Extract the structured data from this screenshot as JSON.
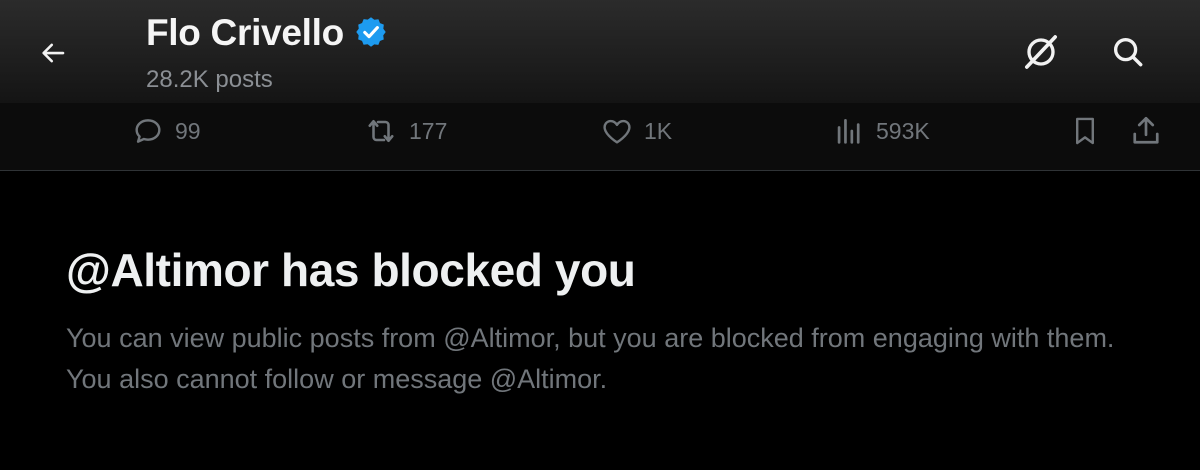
{
  "header": {
    "profile_name": "Flo Crivello",
    "post_count": "28.2K posts",
    "verified": true,
    "verified_color": "#1d9bf0",
    "icons": [
      "back-arrow-icon",
      "grok-icon",
      "search-icon"
    ]
  },
  "actions": {
    "reply_count": "99",
    "repost_count": "177",
    "like_count": "1K",
    "view_count": "593K",
    "icons": [
      "reply-icon",
      "repost-icon",
      "like-icon",
      "views-icon",
      "bookmark-icon",
      "share-icon"
    ],
    "icon_color": "#71767b"
  },
  "blocked": {
    "title": "@Altimor has blocked you",
    "description": "You can view public posts from @Altimor, but you are blocked from engaging with them. You also cannot follow or message @Altimor."
  }
}
